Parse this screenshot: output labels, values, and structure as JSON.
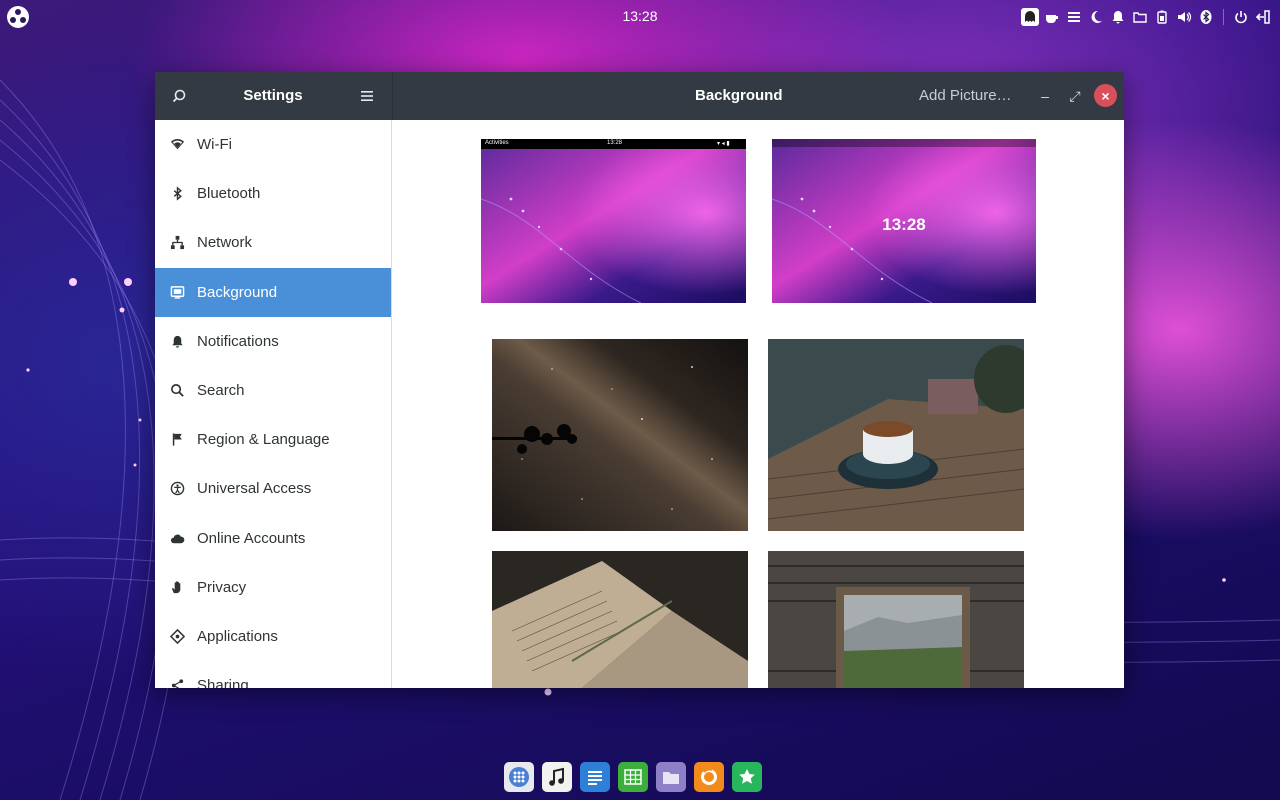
{
  "topbar": {
    "clock": "13:28",
    "tray_icons": [
      "ghost-icon",
      "coffee-icon",
      "list-icon",
      "moon-icon",
      "bell-icon",
      "folder-icon",
      "battery-icon",
      "volume-icon",
      "bluetooth-icon",
      "power-icon",
      "logout-icon"
    ]
  },
  "window": {
    "app_title": "Settings",
    "page_title": "Background",
    "add_picture_label": "Add Picture…",
    "close_glyph": "×",
    "minimize_glyph": "–",
    "maximize_glyph": "⤢"
  },
  "sidebar": {
    "items": [
      {
        "label": "Wi-Fi",
        "icon": "wifi-icon"
      },
      {
        "label": "Bluetooth",
        "icon": "bluetooth-icon"
      },
      {
        "label": "Network",
        "icon": "network-icon"
      },
      {
        "label": "Background",
        "icon": "background-icon",
        "selected": true
      },
      {
        "label": "Notifications",
        "icon": "bell-icon"
      },
      {
        "label": "Search",
        "icon": "search-icon"
      },
      {
        "label": "Region & Language",
        "icon": "flag-icon"
      },
      {
        "label": "Universal Access",
        "icon": "accessibility-icon"
      },
      {
        "label": "Online Accounts",
        "icon": "cloud-icon"
      },
      {
        "label": "Privacy",
        "icon": "hand-icon"
      },
      {
        "label": "Applications",
        "icon": "applications-icon"
      },
      {
        "label": "Sharing",
        "icon": "share-icon"
      }
    ]
  },
  "previews": {
    "desktop_activities": "Activities",
    "desktop_clock": "13:28",
    "lock_clock": "13:28"
  },
  "wallpapers": [
    {
      "name": "milky-way"
    },
    {
      "name": "coffee-cup"
    },
    {
      "name": "old-book"
    },
    {
      "name": "cabin-window"
    }
  ],
  "dock": {
    "apps": [
      "app-grid-icon",
      "music-icon",
      "text-editor-icon",
      "spreadsheet-icon",
      "files-icon",
      "firefox-icon",
      "software-center-icon"
    ]
  },
  "colors": {
    "accent": "#4a90d9",
    "header": "#343a44",
    "close": "#d9505b"
  }
}
